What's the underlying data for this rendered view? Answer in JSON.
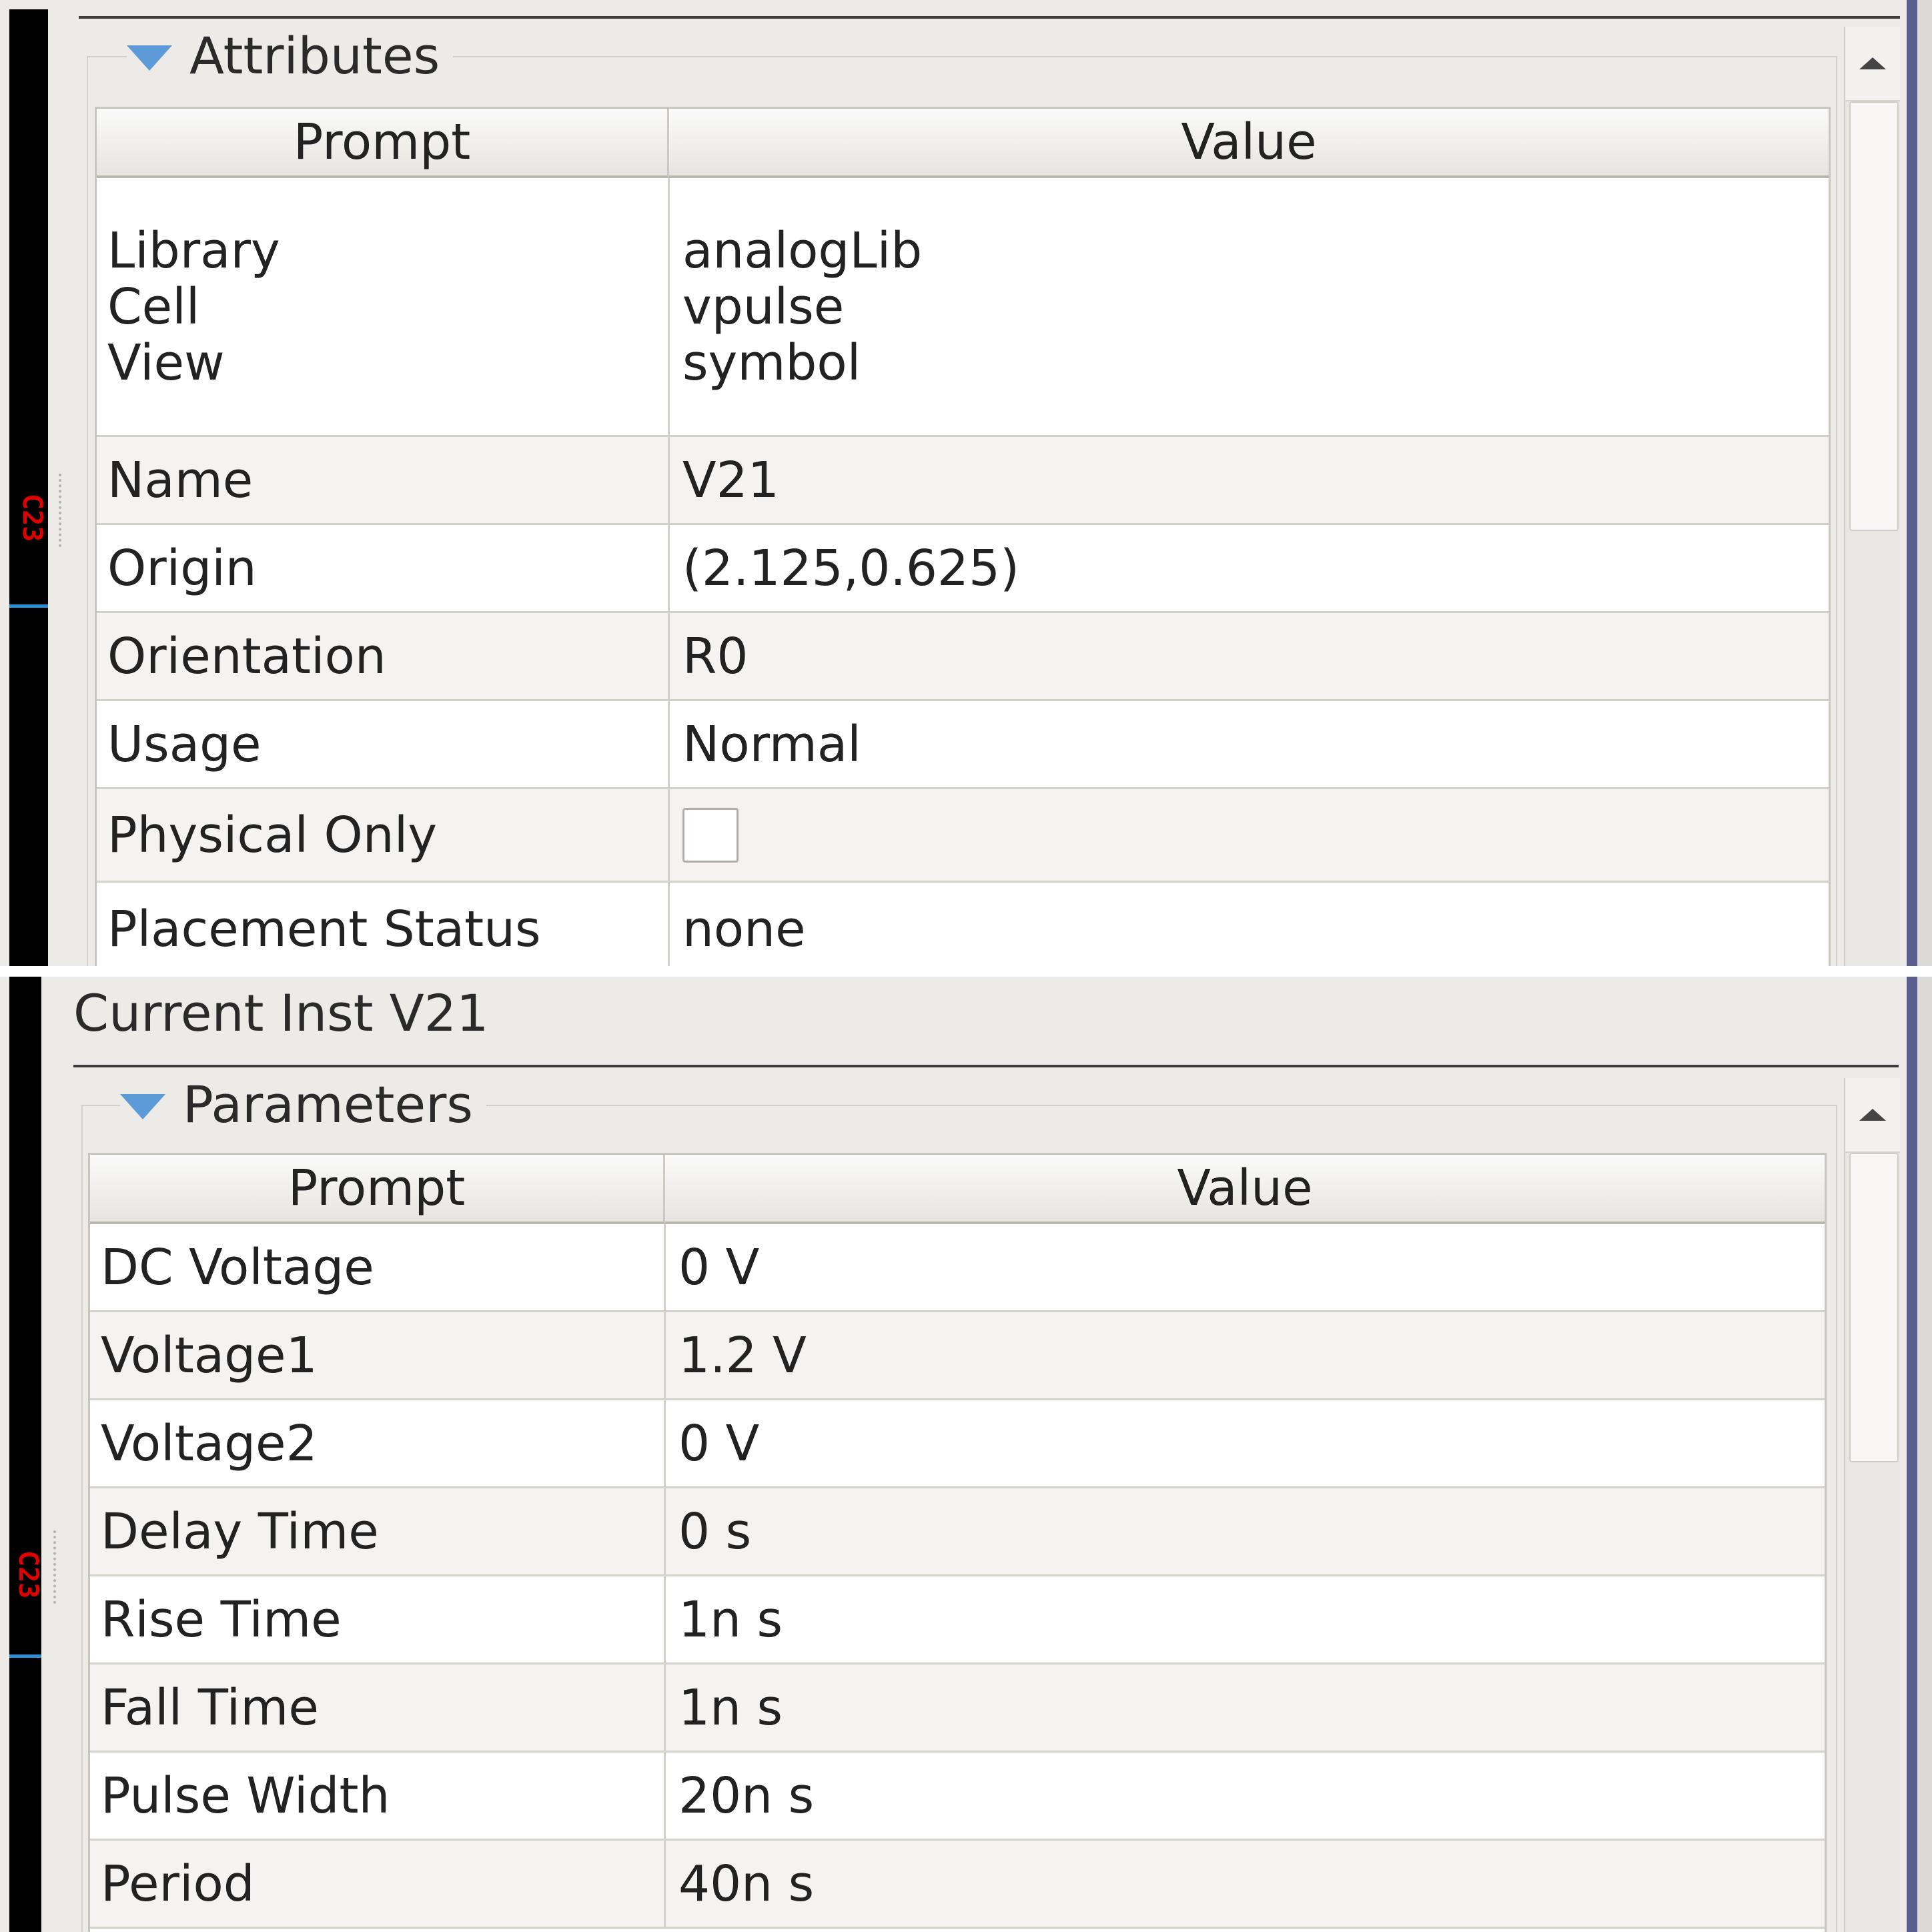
{
  "canvas_label": "C23",
  "attributes": {
    "title": "Attributes",
    "header": {
      "prompt": "Prompt",
      "value": "Value"
    },
    "cellview": {
      "prompts": [
        "Library",
        "Cell",
        "View"
      ],
      "values": [
        "analogLib",
        "vpulse",
        "symbol"
      ]
    },
    "rows": [
      {
        "prompt": "Name",
        "value": "V21"
      },
      {
        "prompt": "Origin",
        "value": "(2.125,0.625)"
      },
      {
        "prompt": "Orientation",
        "value": "R0"
      },
      {
        "prompt": "Usage",
        "value": "Normal"
      },
      {
        "prompt": "Physical Only",
        "value": "",
        "checked": false
      },
      {
        "prompt": "Placement Status",
        "value": "none"
      }
    ]
  },
  "current_inst": "Current Inst V21",
  "parameters": {
    "title": "Parameters",
    "header": {
      "prompt": "Prompt",
      "value": "Value"
    },
    "rows": [
      {
        "prompt": "DC Voltage",
        "value": "0 V"
      },
      {
        "prompt": "Voltage1",
        "value": "1.2 V"
      },
      {
        "prompt": "Voltage2",
        "value": "0 V"
      },
      {
        "prompt": "Delay Time",
        "value": "0 s"
      },
      {
        "prompt": "Rise Time",
        "value": "1n s"
      },
      {
        "prompt": "Fall Time",
        "value": "1n s"
      },
      {
        "prompt": "Pulse Width",
        "value": "20n s"
      },
      {
        "prompt": "Period",
        "value": "40n s"
      }
    ]
  }
}
